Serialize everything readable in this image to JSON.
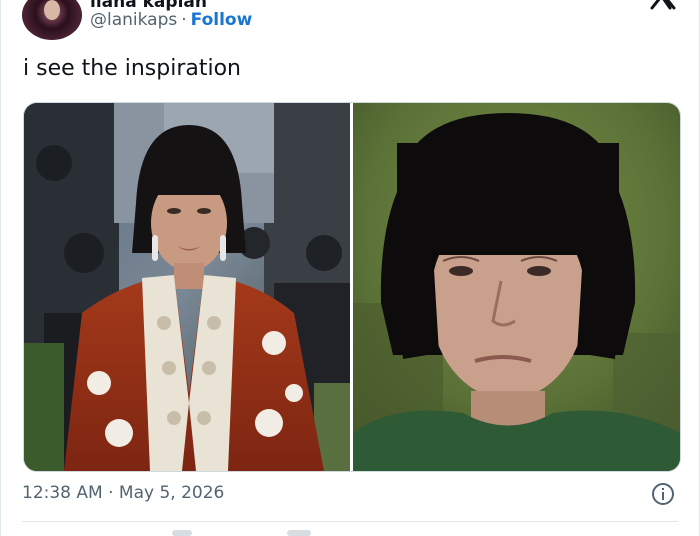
{
  "tweet": {
    "display_name": "ilana kaplan",
    "handle": "@lanikaps",
    "separator": "·",
    "follow_label": "Follow",
    "text": "i see the inspiration",
    "timestamp": "12:38 AM · May 5, 2026"
  },
  "media": {
    "count": 2
  },
  "icons": {
    "logo": "x-logo-icon",
    "info": "info-icon"
  },
  "colors": {
    "follow": "#1876d2",
    "secondary_text": "#536471",
    "border": "#cfd9de"
  }
}
